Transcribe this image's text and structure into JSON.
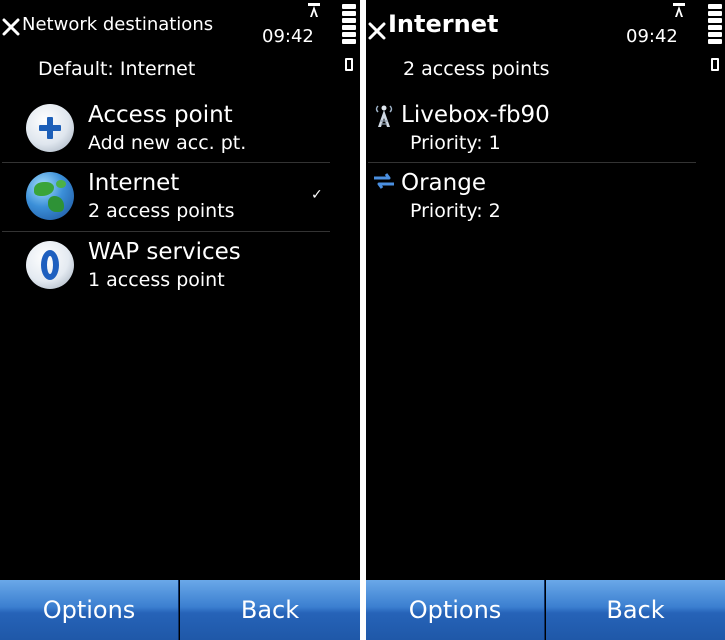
{
  "left_screen": {
    "title": "Network destinations",
    "clock": "09:42",
    "subtitle": "Default: Internet",
    "items": [
      {
        "icon": "plus-icon",
        "title": "Access point",
        "subtitle": "Add new acc. pt."
      },
      {
        "icon": "globe-icon",
        "title": "Internet",
        "subtitle": "2 access points",
        "checked": "✓"
      },
      {
        "icon": "opera-icon",
        "title": "WAP services",
        "subtitle": "1 access point"
      }
    ],
    "softkeys": {
      "left": "Options",
      "right": "Back"
    }
  },
  "right_screen": {
    "title": "Internet",
    "clock": "09:42",
    "subtitle": "2 access points",
    "items": [
      {
        "icon": "wlan-antenna-icon",
        "title": "Livebox-fb90",
        "subtitle": "Priority: 1"
      },
      {
        "icon": "packet-data-arrows-icon",
        "title": "Orange",
        "subtitle": "Priority: 2"
      }
    ],
    "softkeys": {
      "left": "Options",
      "right": "Back"
    }
  },
  "colors": {
    "background": "#000000",
    "softkey_blue": "#2663b8",
    "icon_blue": "#1d5fb8",
    "text": "#ffffff"
  }
}
